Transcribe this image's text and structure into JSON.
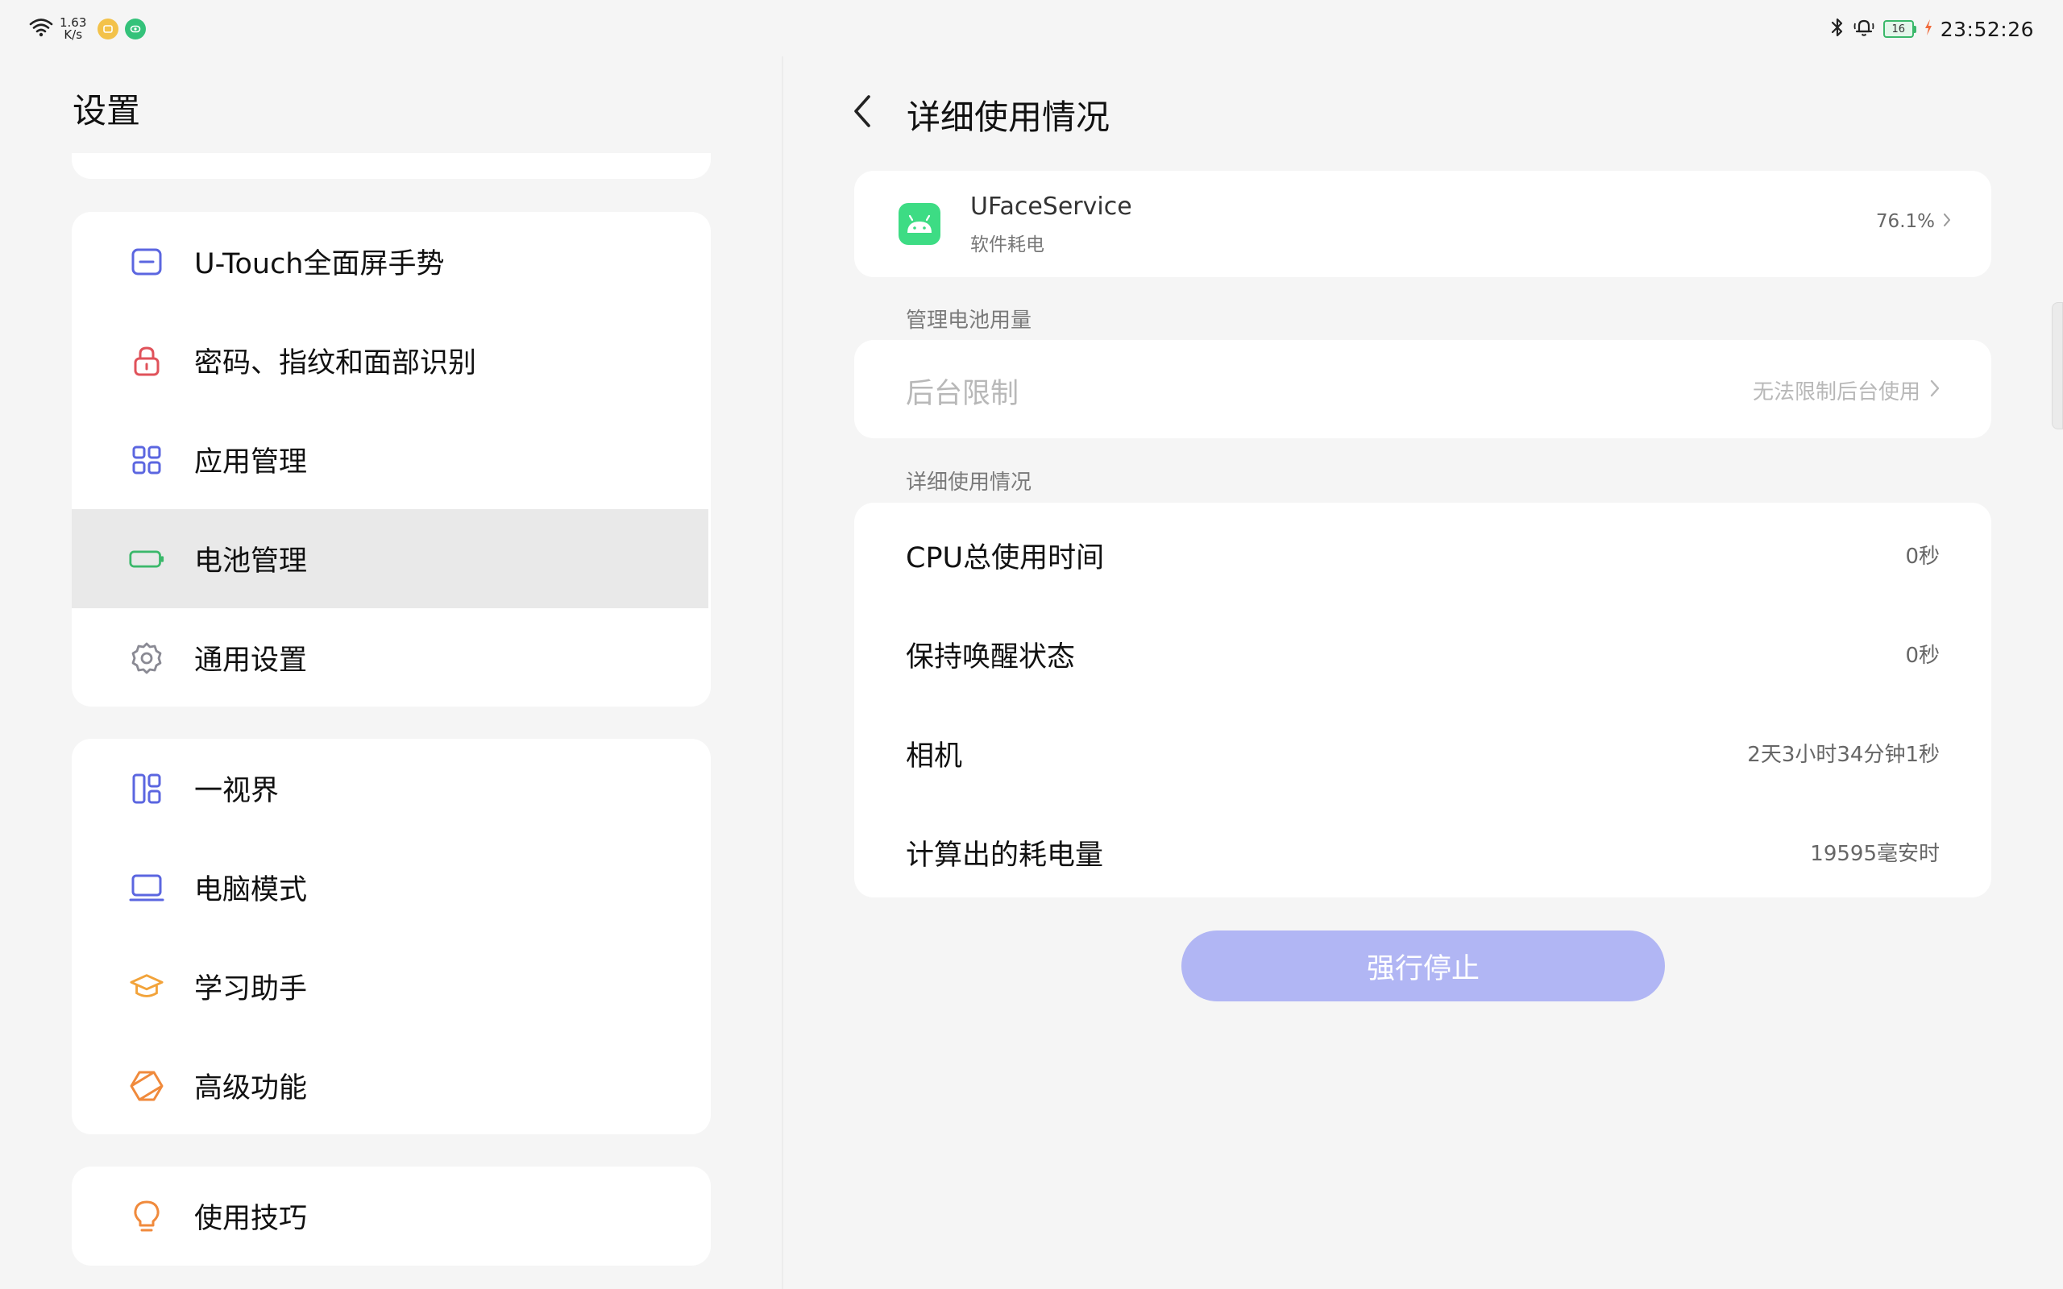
{
  "status_bar": {
    "net_speed_value": "1.63",
    "net_speed_unit": "K/s",
    "battery_level": "16",
    "time": "23:52:26",
    "icons": [
      "wifi-icon",
      "notification-app-icon",
      "notification-app-icon-2",
      "bluetooth-icon",
      "bell-icon",
      "battery-icon",
      "charging-icon"
    ]
  },
  "left_panel": {
    "title": "设置",
    "group1": [
      {
        "label": "U-Touch全面屏手势",
        "icon": "gesture-icon"
      },
      {
        "label": "密码、指纹和面部识别",
        "icon": "lock-icon"
      },
      {
        "label": "应用管理",
        "icon": "apps-grid-icon"
      },
      {
        "label": "电池管理",
        "icon": "battery-icon",
        "selected": true
      },
      {
        "label": "通用设置",
        "icon": "gear-icon"
      }
    ],
    "group2": [
      {
        "label": "一视界",
        "icon": "layout-icon"
      },
      {
        "label": "电脑模式",
        "icon": "laptop-icon"
      },
      {
        "label": "学习助手",
        "icon": "graduation-cap-icon"
      },
      {
        "label": "高级功能",
        "icon": "cube-icon"
      }
    ],
    "group3": [
      {
        "label": "使用技巧",
        "icon": "lightbulb-icon"
      }
    ]
  },
  "right_panel": {
    "title": "详细使用情况",
    "app": {
      "name": "UFaceService",
      "subtitle": "软件耗电",
      "percent": "76.1%",
      "icon": "android-icon"
    },
    "section_manage": "管理电池用量",
    "background_limit": {
      "label": "后台限制",
      "value": "无法限制后台使用"
    },
    "section_detail": "详细使用情况",
    "details": [
      {
        "label": "CPU总使用时间",
        "value": "0秒"
      },
      {
        "label": "保持唤醒状态",
        "value": "0秒"
      },
      {
        "label": "相机",
        "value": "2天3小时34分钟1秒"
      },
      {
        "label": "计算出的耗电量",
        "value": "19595毫安时"
      }
    ],
    "force_stop_label": "强行停止"
  },
  "colors": {
    "accent": "#5b66e0",
    "force_stop_bg": "#b1b6f4",
    "battery_green": "#3ab86a",
    "lock_red": "#e0525a",
    "orange": "#f08a3c"
  }
}
